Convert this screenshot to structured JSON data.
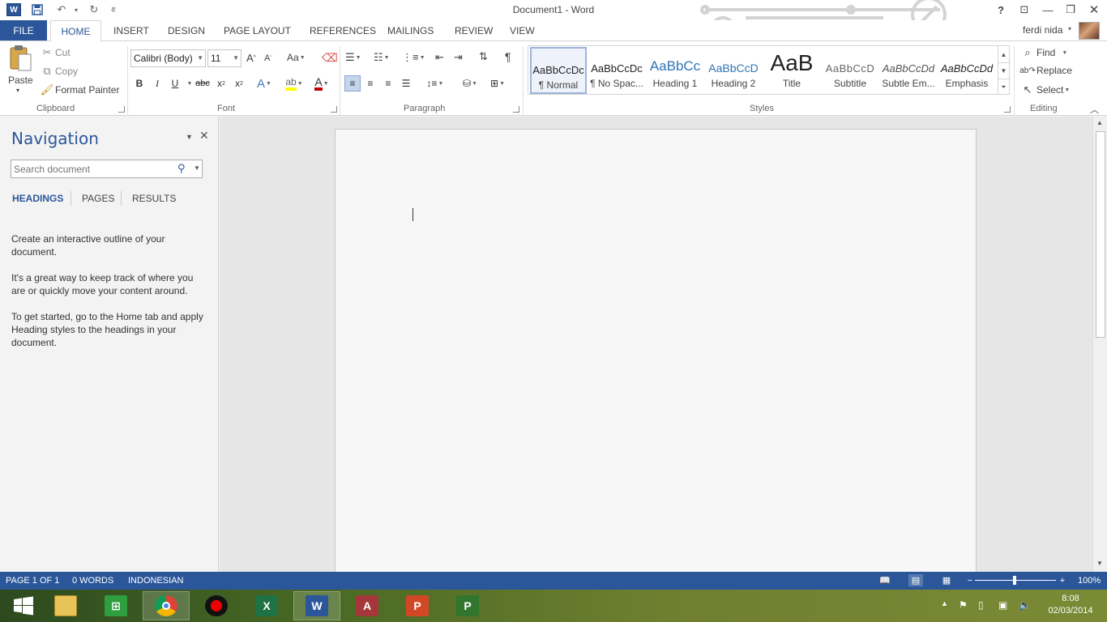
{
  "window": {
    "title": "Document1 - Word",
    "user": "ferdi nida"
  },
  "tabs": {
    "file": "FILE",
    "home": "HOME",
    "insert": "INSERT",
    "design": "DESIGN",
    "page_layout": "PAGE LAYOUT",
    "references": "REFERENCES",
    "mailings": "MAILINGS",
    "review": "REVIEW",
    "view": "VIEW"
  },
  "clipboard": {
    "label": "Clipboard",
    "paste": "Paste",
    "cut": "Cut",
    "copy": "Copy",
    "format_painter": "Format Painter"
  },
  "font": {
    "label": "Font",
    "family": "Calibri (Body)",
    "size": "11"
  },
  "paragraph": {
    "label": "Paragraph"
  },
  "styles": {
    "label": "Styles",
    "items": [
      {
        "sample": "AaBbCcDc",
        "name": "¶ Normal"
      },
      {
        "sample": "AaBbCcDc",
        "name": "¶ No Spac..."
      },
      {
        "sample": "AaBbCc",
        "name": "Heading 1"
      },
      {
        "sample": "AaBbCcD",
        "name": "Heading 2"
      },
      {
        "sample": "AaB",
        "name": "Title"
      },
      {
        "sample": "AaBbCcD",
        "name": "Subtitle"
      },
      {
        "sample": "AaBbCcDd",
        "name": "Subtle Em..."
      },
      {
        "sample": "AaBbCcDd",
        "name": "Emphasis"
      }
    ]
  },
  "editing": {
    "label": "Editing",
    "find": "Find",
    "replace": "Replace",
    "select": "Select"
  },
  "navigation": {
    "title": "Navigation",
    "search_placeholder": "Search document",
    "tabs": [
      "HEADINGS",
      "PAGES",
      "RESULTS"
    ],
    "paragraphs": [
      "Create an interactive outline of your document.",
      "It's a great way to keep track of where you are or quickly move your content around.",
      "To get started, go to the Home tab and apply Heading styles to the headings in your document."
    ]
  },
  "status": {
    "page": "PAGE 1 OF 1",
    "words": "0 WORDS",
    "language": "INDONESIAN",
    "zoom": "100%"
  },
  "clock": {
    "time": "8:08",
    "date": "02/03/2014"
  },
  "colors": {
    "accent": "#2b579a",
    "highlight": "#ffff00",
    "font_color": "#c00000"
  }
}
